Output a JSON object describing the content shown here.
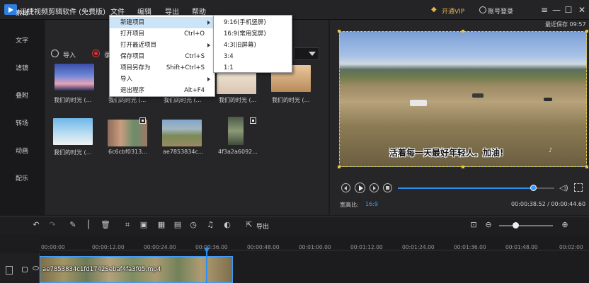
{
  "app": {
    "title": "迅捷视频剪辑软件 (免费版)",
    "menu": [
      "文件",
      "编辑",
      "导出",
      "帮助"
    ],
    "vip_label": "开通VIP",
    "login_label": "账号登录"
  },
  "sidebar": {
    "items": [
      {
        "label": "素材",
        "active": true
      },
      {
        "label": "文字",
        "active": false
      },
      {
        "label": "滤镜",
        "active": false
      },
      {
        "label": "叠附",
        "active": false
      },
      {
        "label": "转场",
        "active": false
      },
      {
        "label": "动画",
        "active": false
      },
      {
        "label": "配乐",
        "active": false
      }
    ]
  },
  "media": {
    "import_label": "导入",
    "record_label": "录",
    "items": [
      {
        "label": "我们的时光 (..."
      },
      {
        "label": "我们的时光 (..."
      },
      {
        "label": "我们的时光 (..."
      },
      {
        "label": "我们的时光 (..."
      },
      {
        "label": "我们的时光 (..."
      },
      {
        "label": "我们的时光 (..."
      },
      {
        "label": "6c6cbf0313..."
      },
      {
        "label": "ae7853834c..."
      },
      {
        "label": "4f3a2a6092..."
      }
    ]
  },
  "file_menu": {
    "items": [
      {
        "label": "新建项目",
        "shortcut": "",
        "submenu": true
      },
      {
        "label": "打开项目",
        "shortcut": "Ctrl+O",
        "submenu": false
      },
      {
        "label": "打开最近项目",
        "shortcut": "",
        "submenu": true
      },
      {
        "label": "保存项目",
        "shortcut": "Ctrl+S",
        "submenu": false
      },
      {
        "label": "项目另存为",
        "shortcut": "Shift+Ctrl+S",
        "submenu": false
      },
      {
        "label": "导入",
        "shortcut": "",
        "submenu": true
      },
      {
        "label": "退出程序",
        "shortcut": "Alt+F4",
        "submenu": false
      }
    ],
    "submenu_items": [
      {
        "label": "9:16(手机竖屏)"
      },
      {
        "label": "16:9(常用宽屏)"
      },
      {
        "label": "4:3(旧屏幕)"
      },
      {
        "label": "3:4"
      },
      {
        "label": "1:1"
      }
    ]
  },
  "preview": {
    "save_status": "最近保存 09:57",
    "subtitle": "活着每一天最好年轻人。加油!",
    "watermark": "♪",
    "ratio_label": "宽高比:",
    "ratio_value": "16:9",
    "time": "00:00:38.52 / 00:00:44.60",
    "progress": 0.863
  },
  "toolbar": {
    "export_label": "导出",
    "zoom_level": 0.3
  },
  "timeline": {
    "ticks": [
      "00:00:00",
      "00:00:12.00",
      "00:00:24.00",
      "00:00:36.00",
      "00:00:48.00",
      "00:01:00.00",
      "00:01:12.00",
      "00:01:24.00",
      "00:01:36.00",
      "00:01:48.00",
      "00:02:00"
    ],
    "clip_label": "ae7853834c1fd1742Sebaf4fa3f05.mp4"
  },
  "colors": {
    "accent": "#2b8ef0",
    "vip": "#e6b24a",
    "selection": "#e3c53b"
  }
}
